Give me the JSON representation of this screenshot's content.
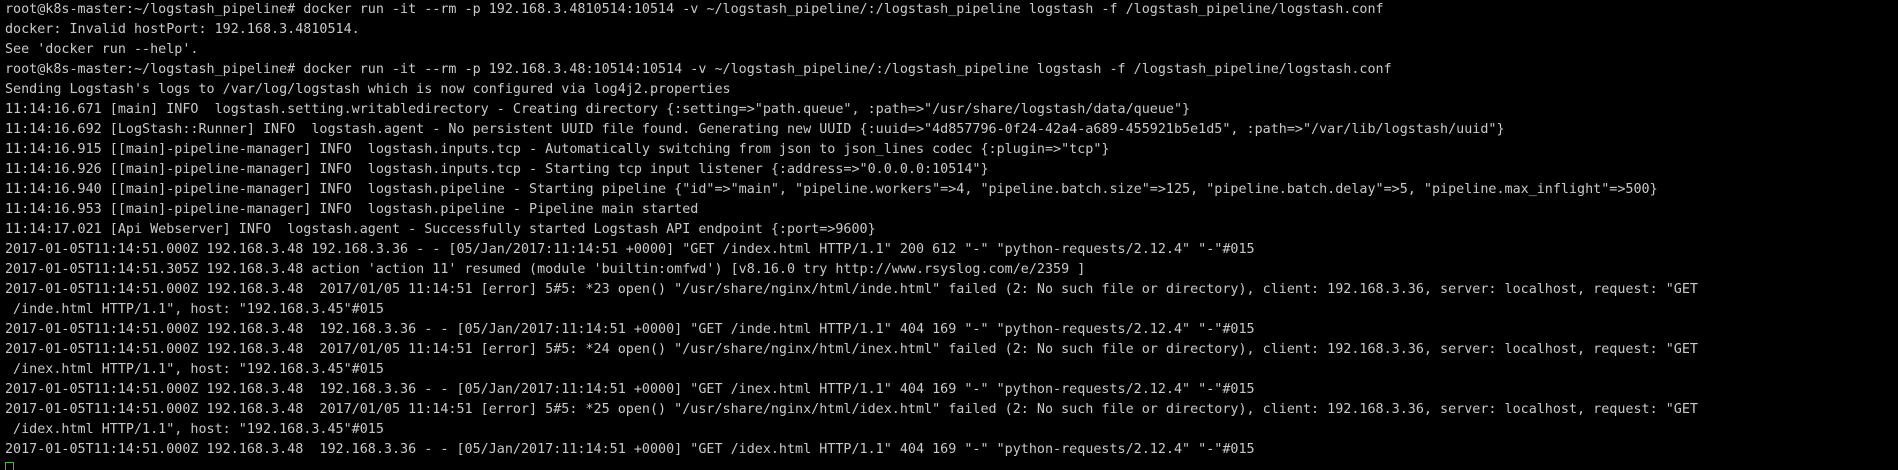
{
  "terminal": {
    "lines": [
      "root@k8s-master:~/logstash_pipeline# docker run -it --rm -p 192.168.3.4810514:10514 -v ~/logstash_pipeline/:/logstash_pipeline logstash -f /logstash_pipeline/logstash.conf",
      "docker: Invalid hostPort: 192.168.3.4810514.",
      "See 'docker run --help'.",
      "root@k8s-master:~/logstash_pipeline# docker run -it --rm -p 192.168.3.48:10514:10514 -v ~/logstash_pipeline/:/logstash_pipeline logstash -f /logstash_pipeline/logstash.conf",
      "Sending Logstash's logs to /var/log/logstash which is now configured via log4j2.properties",
      "11:14:16.671 [main] INFO  logstash.setting.writabledirectory - Creating directory {:setting=>\"path.queue\", :path=>\"/usr/share/logstash/data/queue\"}",
      "11:14:16.692 [LogStash::Runner] INFO  logstash.agent - No persistent UUID file found. Generating new UUID {:uuid=>\"4d857796-0f24-42a4-a689-455921b5e1d5\", :path=>\"/var/lib/logstash/uuid\"}",
      "11:14:16.915 [[main]-pipeline-manager] INFO  logstash.inputs.tcp - Automatically switching from json to json_lines codec {:plugin=>\"tcp\"}",
      "11:14:16.926 [[main]-pipeline-manager] INFO  logstash.inputs.tcp - Starting tcp input listener {:address=>\"0.0.0.0:10514\"}",
      "11:14:16.940 [[main]-pipeline-manager] INFO  logstash.pipeline - Starting pipeline {\"id\"=>\"main\", \"pipeline.workers\"=>4, \"pipeline.batch.size\"=>125, \"pipeline.batch.delay\"=>5, \"pipeline.max_inflight\"=>500}",
      "11:14:16.953 [[main]-pipeline-manager] INFO  logstash.pipeline - Pipeline main started",
      "11:14:17.021 [Api Webserver] INFO  logstash.agent - Successfully started Logstash API endpoint {:port=>9600}",
      "2017-01-05T11:14:51.000Z 192.168.3.48 192.168.3.36 - - [05/Jan/2017:11:14:51 +0000] \"GET /index.html HTTP/1.1\" 200 612 \"-\" \"python-requests/2.12.4\" \"-\"#015",
      "2017-01-05T11:14:51.305Z 192.168.3.48 action 'action 11' resumed (module 'builtin:omfwd') [v8.16.0 try http://www.rsyslog.com/e/2359 ]",
      "2017-01-05T11:14:51.000Z 192.168.3.48  2017/01/05 11:14:51 [error] 5#5: *23 open() \"/usr/share/nginx/html/inde.html\" failed (2: No such file or directory), client: 192.168.3.36, server: localhost, request: \"GET",
      " /inde.html HTTP/1.1\", host: \"192.168.3.45\"#015",
      "2017-01-05T11:14:51.000Z 192.168.3.48  192.168.3.36 - - [05/Jan/2017:11:14:51 +0000] \"GET /inde.html HTTP/1.1\" 404 169 \"-\" \"python-requests/2.12.4\" \"-\"#015",
      "2017-01-05T11:14:51.000Z 192.168.3.48  2017/01/05 11:14:51 [error] 5#5: *24 open() \"/usr/share/nginx/html/inex.html\" failed (2: No such file or directory), client: 192.168.3.36, server: localhost, request: \"GET",
      " /inex.html HTTP/1.1\", host: \"192.168.3.45\"#015",
      "2017-01-05T11:14:51.000Z 192.168.3.48  192.168.3.36 - - [05/Jan/2017:11:14:51 +0000] \"GET /inex.html HTTP/1.1\" 404 169 \"-\" \"python-requests/2.12.4\" \"-\"#015",
      "2017-01-05T11:14:51.000Z 192.168.3.48  2017/01/05 11:14:51 [error] 5#5: *25 open() \"/usr/share/nginx/html/idex.html\" failed (2: No such file or directory), client: 192.168.3.36, server: localhost, request: \"GET",
      " /idex.html HTTP/1.1\", host: \"192.168.3.45\"#015",
      "2017-01-05T11:14:51.000Z 192.168.3.48  192.168.3.36 - - [05/Jan/2017:11:14:51 +0000] \"GET /idex.html HTTP/1.1\" 404 169 \"-\" \"python-requests/2.12.4\" \"-\"#015"
    ]
  },
  "colors": {
    "background": "#000000",
    "text": "#c9c9c9",
    "cursor": "#1fd31f"
  }
}
